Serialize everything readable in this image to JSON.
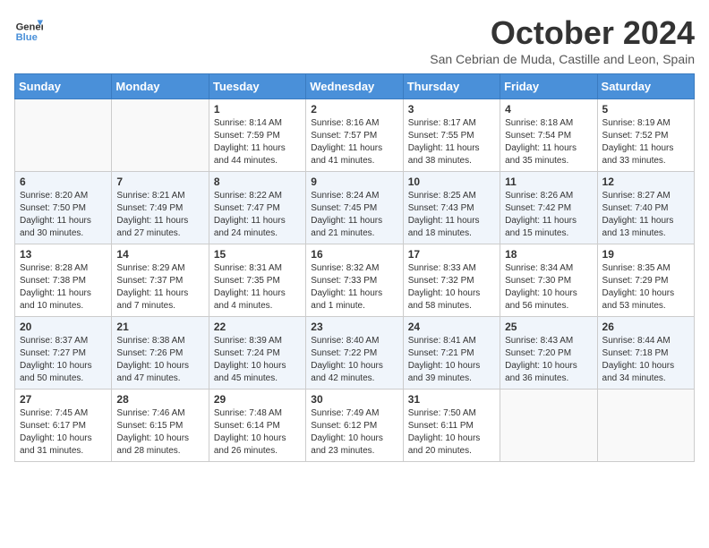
{
  "header": {
    "logo_line1": "General",
    "logo_line2": "Blue",
    "month_title": "October 2024",
    "subtitle": "San Cebrian de Muda, Castille and Leon, Spain"
  },
  "days_of_week": [
    "Sunday",
    "Monday",
    "Tuesday",
    "Wednesday",
    "Thursday",
    "Friday",
    "Saturday"
  ],
  "weeks": [
    [
      {
        "day": "",
        "info": ""
      },
      {
        "day": "",
        "info": ""
      },
      {
        "day": "1",
        "info": "Sunrise: 8:14 AM\nSunset: 7:59 PM\nDaylight: 11 hours and 44 minutes."
      },
      {
        "day": "2",
        "info": "Sunrise: 8:16 AM\nSunset: 7:57 PM\nDaylight: 11 hours and 41 minutes."
      },
      {
        "day": "3",
        "info": "Sunrise: 8:17 AM\nSunset: 7:55 PM\nDaylight: 11 hours and 38 minutes."
      },
      {
        "day": "4",
        "info": "Sunrise: 8:18 AM\nSunset: 7:54 PM\nDaylight: 11 hours and 35 minutes."
      },
      {
        "day": "5",
        "info": "Sunrise: 8:19 AM\nSunset: 7:52 PM\nDaylight: 11 hours and 33 minutes."
      }
    ],
    [
      {
        "day": "6",
        "info": "Sunrise: 8:20 AM\nSunset: 7:50 PM\nDaylight: 11 hours and 30 minutes."
      },
      {
        "day": "7",
        "info": "Sunrise: 8:21 AM\nSunset: 7:49 PM\nDaylight: 11 hours and 27 minutes."
      },
      {
        "day": "8",
        "info": "Sunrise: 8:22 AM\nSunset: 7:47 PM\nDaylight: 11 hours and 24 minutes."
      },
      {
        "day": "9",
        "info": "Sunrise: 8:24 AM\nSunset: 7:45 PM\nDaylight: 11 hours and 21 minutes."
      },
      {
        "day": "10",
        "info": "Sunrise: 8:25 AM\nSunset: 7:43 PM\nDaylight: 11 hours and 18 minutes."
      },
      {
        "day": "11",
        "info": "Sunrise: 8:26 AM\nSunset: 7:42 PM\nDaylight: 11 hours and 15 minutes."
      },
      {
        "day": "12",
        "info": "Sunrise: 8:27 AM\nSunset: 7:40 PM\nDaylight: 11 hours and 13 minutes."
      }
    ],
    [
      {
        "day": "13",
        "info": "Sunrise: 8:28 AM\nSunset: 7:38 PM\nDaylight: 11 hours and 10 minutes."
      },
      {
        "day": "14",
        "info": "Sunrise: 8:29 AM\nSunset: 7:37 PM\nDaylight: 11 hours and 7 minutes."
      },
      {
        "day": "15",
        "info": "Sunrise: 8:31 AM\nSunset: 7:35 PM\nDaylight: 11 hours and 4 minutes."
      },
      {
        "day": "16",
        "info": "Sunrise: 8:32 AM\nSunset: 7:33 PM\nDaylight: 11 hours and 1 minute."
      },
      {
        "day": "17",
        "info": "Sunrise: 8:33 AM\nSunset: 7:32 PM\nDaylight: 10 hours and 58 minutes."
      },
      {
        "day": "18",
        "info": "Sunrise: 8:34 AM\nSunset: 7:30 PM\nDaylight: 10 hours and 56 minutes."
      },
      {
        "day": "19",
        "info": "Sunrise: 8:35 AM\nSunset: 7:29 PM\nDaylight: 10 hours and 53 minutes."
      }
    ],
    [
      {
        "day": "20",
        "info": "Sunrise: 8:37 AM\nSunset: 7:27 PM\nDaylight: 10 hours and 50 minutes."
      },
      {
        "day": "21",
        "info": "Sunrise: 8:38 AM\nSunset: 7:26 PM\nDaylight: 10 hours and 47 minutes."
      },
      {
        "day": "22",
        "info": "Sunrise: 8:39 AM\nSunset: 7:24 PM\nDaylight: 10 hours and 45 minutes."
      },
      {
        "day": "23",
        "info": "Sunrise: 8:40 AM\nSunset: 7:22 PM\nDaylight: 10 hours and 42 minutes."
      },
      {
        "day": "24",
        "info": "Sunrise: 8:41 AM\nSunset: 7:21 PM\nDaylight: 10 hours and 39 minutes."
      },
      {
        "day": "25",
        "info": "Sunrise: 8:43 AM\nSunset: 7:20 PM\nDaylight: 10 hours and 36 minutes."
      },
      {
        "day": "26",
        "info": "Sunrise: 8:44 AM\nSunset: 7:18 PM\nDaylight: 10 hours and 34 minutes."
      }
    ],
    [
      {
        "day": "27",
        "info": "Sunrise: 7:45 AM\nSunset: 6:17 PM\nDaylight: 10 hours and 31 minutes."
      },
      {
        "day": "28",
        "info": "Sunrise: 7:46 AM\nSunset: 6:15 PM\nDaylight: 10 hours and 28 minutes."
      },
      {
        "day": "29",
        "info": "Sunrise: 7:48 AM\nSunset: 6:14 PM\nDaylight: 10 hours and 26 minutes."
      },
      {
        "day": "30",
        "info": "Sunrise: 7:49 AM\nSunset: 6:12 PM\nDaylight: 10 hours and 23 minutes."
      },
      {
        "day": "31",
        "info": "Sunrise: 7:50 AM\nSunset: 6:11 PM\nDaylight: 10 hours and 20 minutes."
      },
      {
        "day": "",
        "info": ""
      },
      {
        "day": "",
        "info": ""
      }
    ]
  ]
}
